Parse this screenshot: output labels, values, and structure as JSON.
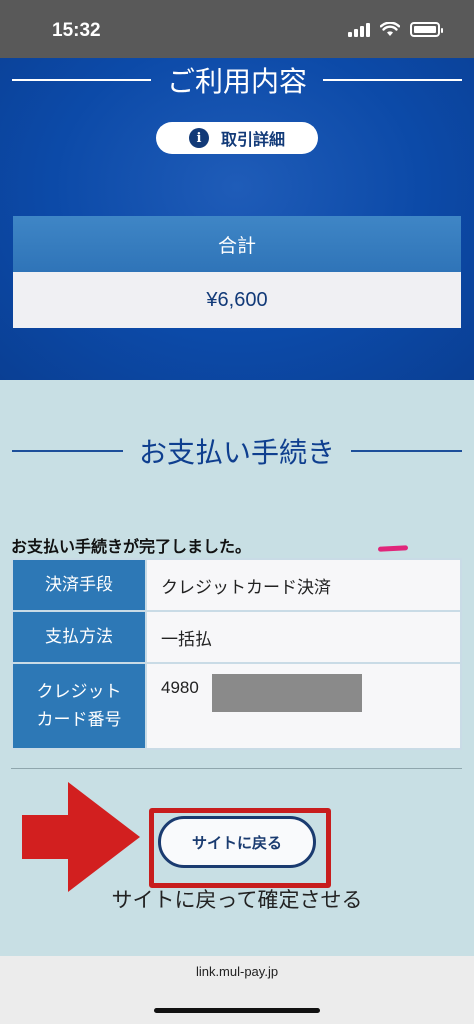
{
  "status_bar": {
    "time": "15:32",
    "signal_icon": "signal-bars-icon",
    "wifi_icon": "wifi-icon",
    "battery_icon": "battery-icon"
  },
  "usage": {
    "heading": "ご利用内容",
    "detail_button": {
      "icon": "info-icon",
      "icon_glyph": "i",
      "label": "取引詳細"
    },
    "total_label": "合計",
    "total_value": "¥6,600"
  },
  "payment": {
    "heading": "お支払い手続き",
    "complete_message": "お支払い手続きが完了しました。",
    "rows": [
      {
        "label": "決済手段",
        "value": "クレジットカード決済"
      },
      {
        "label": "支払方法",
        "value": "一括払"
      },
      {
        "label_line1": "クレジット",
        "label_line2": "カード番号",
        "value_prefix": "4980"
      }
    ]
  },
  "annotation": {
    "arrow_color": "#d21f1f",
    "frame_color": "#c81d1d",
    "caption": "サイトに戻って確定させる"
  },
  "back_button": {
    "label": "サイトに戻る"
  },
  "browser": {
    "url": "link.mul-pay.jp"
  },
  "colors": {
    "primary_blue": "#0c4aa8",
    "table_header": "#2d78b6",
    "background": "#c8dfe4"
  }
}
